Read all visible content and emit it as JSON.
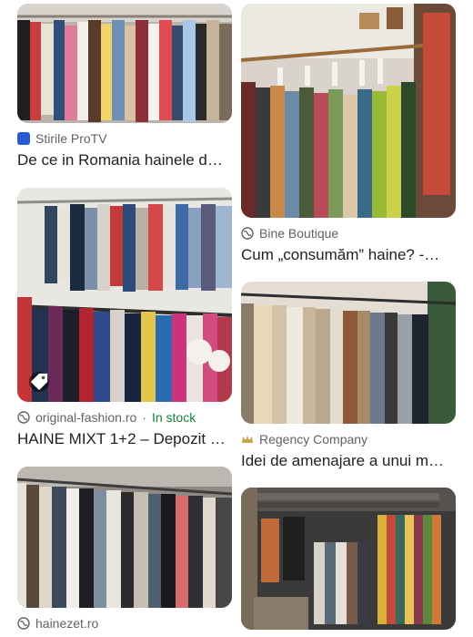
{
  "results": [
    {
      "source": "Stirile ProTV",
      "title": "De ce in Romania hainele d…",
      "favicon": "protv-logo-icon"
    },
    {
      "source": "Bine Boutique",
      "title": "Cum „consumăm” haine? -…",
      "favicon": "globe-icon"
    },
    {
      "source": "original-fashion.ro",
      "stock": "In stock",
      "title": "HAINE MIXT 1+2 – Depozit …",
      "favicon": "globe-icon"
    },
    {
      "source": "Regency Company",
      "title": "Idei de amenajare a unui m…",
      "favicon": "crown-icon"
    },
    {
      "source": "hainezet.ro",
      "title": "",
      "favicon": "globe-icon"
    }
  ],
  "colors": {
    "source_text": "#5f6368",
    "title_text": "#202124",
    "stock_green": "#188038"
  }
}
